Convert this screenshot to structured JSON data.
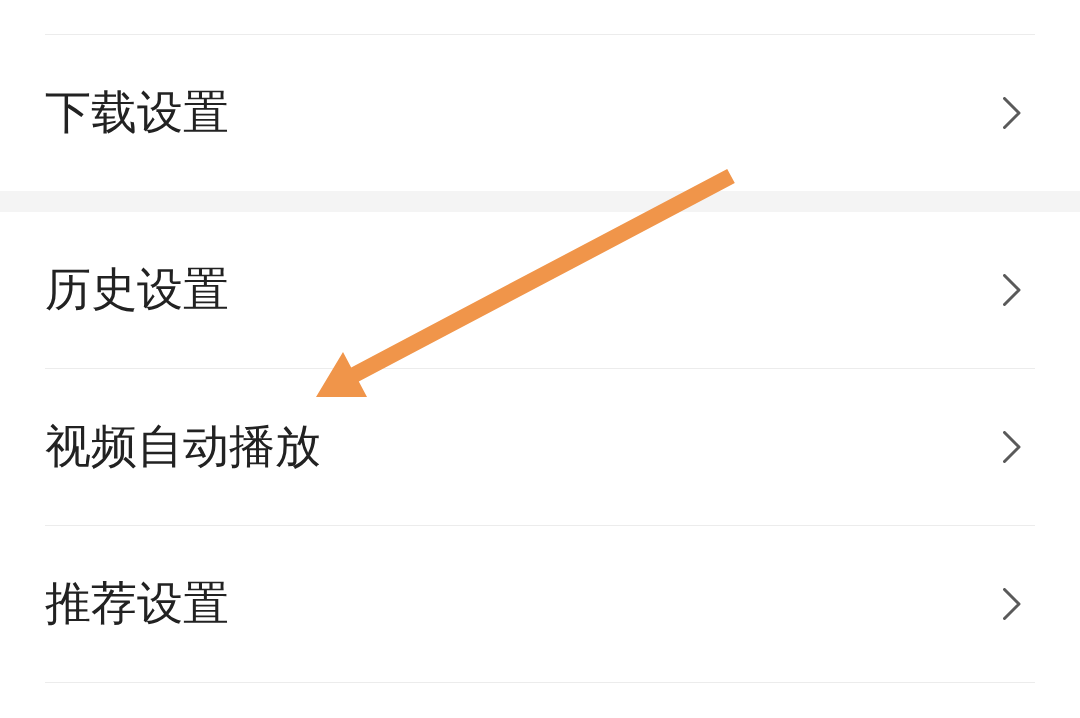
{
  "settings_groups": [
    {
      "items": [
        {
          "label": "下载设置"
        }
      ]
    },
    {
      "items": [
        {
          "label": "历史设置"
        },
        {
          "label": "视频自动播放"
        },
        {
          "label": "推荐设置"
        }
      ]
    }
  ]
}
